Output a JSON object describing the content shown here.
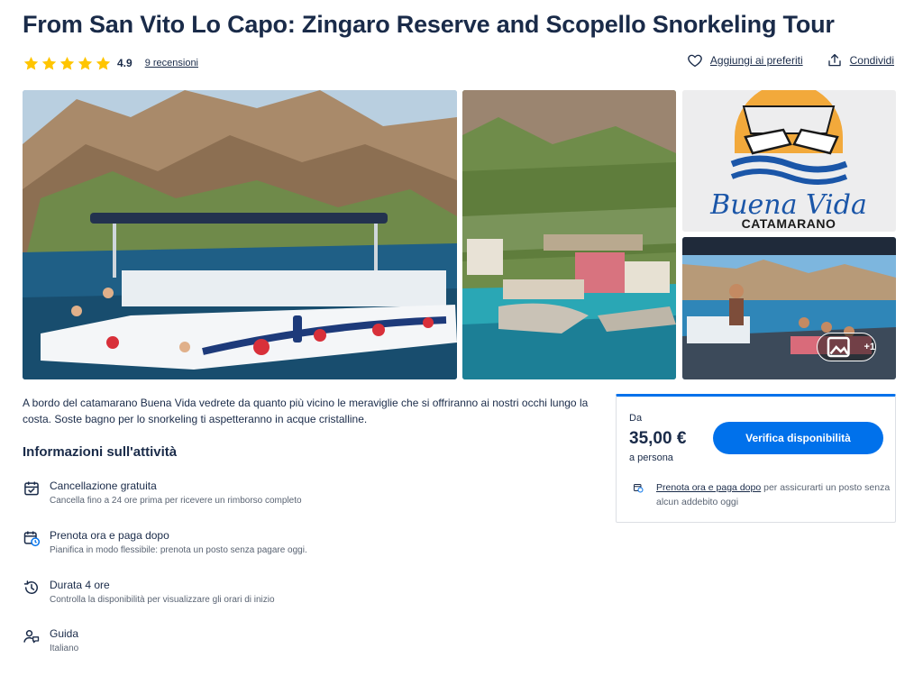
{
  "header": {
    "title": "From San Vito Lo Capo: Zingaro Reserve and Scopello Snorkeling Tour",
    "rating_value": "4.9",
    "rating_stars": 5,
    "reviews_link": "9 recensioni",
    "favorite_label": "Aggiungi ai preferiti",
    "share_label": "Condividi"
  },
  "gallery": {
    "logo_text": "Buena Vida",
    "logo_subtext": "CATAMARANO",
    "more_badge": "+1"
  },
  "description": "A bordo del catamarano Buena Vida vedrete da quanto più vicino le meraviglie che si offriranno ai nostri occhi lungo la costa. Soste bagno per lo snorkeling ti aspetteranno in acque cristalline.",
  "info": {
    "section_title": "Informazioni sull'attività",
    "items": [
      {
        "icon": "calendar-check-icon",
        "title": "Cancellazione gratuita",
        "subtitle": "Cancella fino a 24 ore prima per ricevere un rimborso completo"
      },
      {
        "icon": "calendar-clock-icon",
        "title": "Prenota ora e paga dopo",
        "subtitle": "Pianifica in modo flessibile: prenota un posto senza pagare oggi."
      },
      {
        "icon": "clock-history-icon",
        "title": "Durata 4 ore",
        "subtitle": "Controlla la disponibilità per visualizzare gli orari di inizio"
      },
      {
        "icon": "guide-icon",
        "title": "Guida",
        "subtitle": "Italiano"
      }
    ]
  },
  "booking": {
    "from_label": "Da",
    "price": "35,00 €",
    "per_person": "a persona",
    "check_button": "Verifica disponibilità",
    "book_later_link": "Prenota ora e paga dopo",
    "book_later_text": " per assicurarti un posto senza alcun addebito oggi"
  },
  "colors": {
    "primary_blue": "#0071eb",
    "text_dark": "#1a2b49",
    "star_yellow": "#ffc500",
    "text_muted": "#5a6473"
  }
}
